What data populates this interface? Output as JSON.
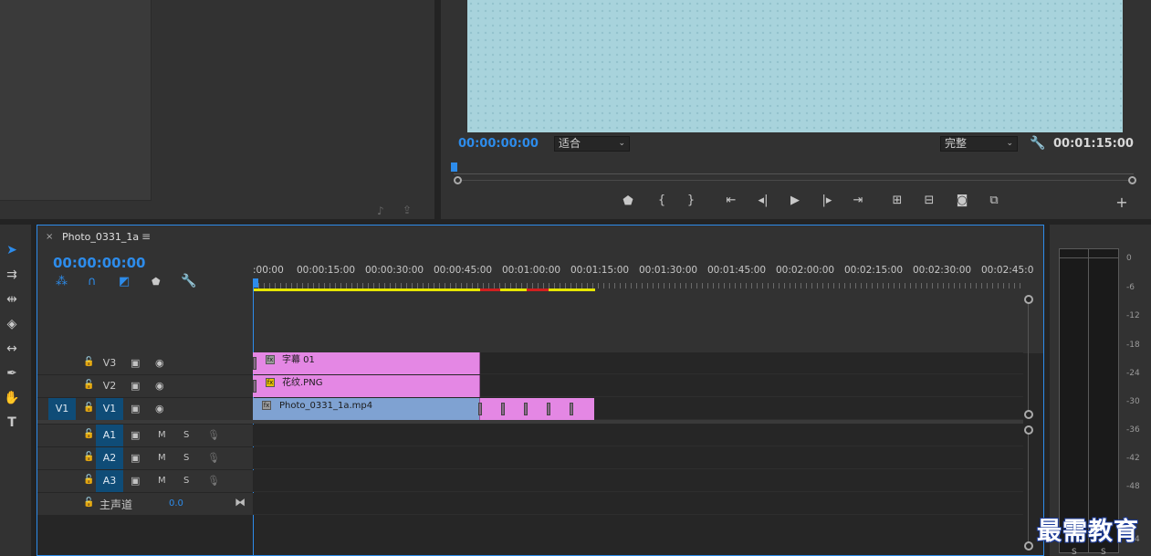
{
  "program_monitor": {
    "playhead_timecode": "00:00:00:00",
    "zoom_select": "适合",
    "quality_select": "完整",
    "duration_timecode": "00:01:15:00"
  },
  "timeline": {
    "sequence_name": "Photo_0331_1a",
    "playhead_timecode": "00:00:00:00",
    "ruler_ticks": [
      ":00:00",
      "00:00:15:00",
      "00:00:30:00",
      "00:00:45:00",
      "00:01:00:00",
      "00:01:15:00",
      "00:01:30:00",
      "00:01:45:00",
      "00:02:00:00",
      "00:02:15:00",
      "00:02:30:00",
      "00:02:45:0"
    ],
    "video_tracks": [
      {
        "source": "",
        "name": "V3"
      },
      {
        "source": "",
        "name": "V2"
      },
      {
        "source": "V1",
        "name": "V1"
      }
    ],
    "audio_tracks": [
      {
        "name": "A1",
        "m": "M",
        "s": "S"
      },
      {
        "name": "A2",
        "m": "M",
        "s": "S"
      },
      {
        "name": "A3",
        "m": "M",
        "s": "S"
      }
    ],
    "master": {
      "label": "主声道",
      "value": "0.0"
    },
    "clips": [
      {
        "track": "V3",
        "name": "字幕 01"
      },
      {
        "track": "V2",
        "name": "花纹.PNG"
      },
      {
        "track": "V1",
        "name": "Photo_0331_1a.mp4"
      }
    ]
  },
  "audio_meter": {
    "db_labels": [
      "0",
      "-6",
      "-12",
      "-18",
      "-24",
      "-30",
      "-36",
      "-42",
      "-48",
      "-54"
    ],
    "bottom_labels": [
      "S",
      "S"
    ]
  },
  "watermark": "最需教育",
  "icons": [
    "selection-tool",
    "track-select-tool",
    "ripple-edit-tool",
    "razor-tool",
    "slip-tool",
    "pen-tool",
    "hand-tool",
    "type-tool",
    "wrench-icon",
    "marker-icon",
    "play-icon",
    "camera-icon",
    "lock-icon",
    "eye-icon",
    "film-icon",
    "mic-icon"
  ],
  "colors": {
    "accent_blue": "#2d8ceb",
    "clip_pink": "#e487e4",
    "clip_blue": "#7fa2d2",
    "track_target": "#0f4c77",
    "work_area": "#e5e500"
  }
}
